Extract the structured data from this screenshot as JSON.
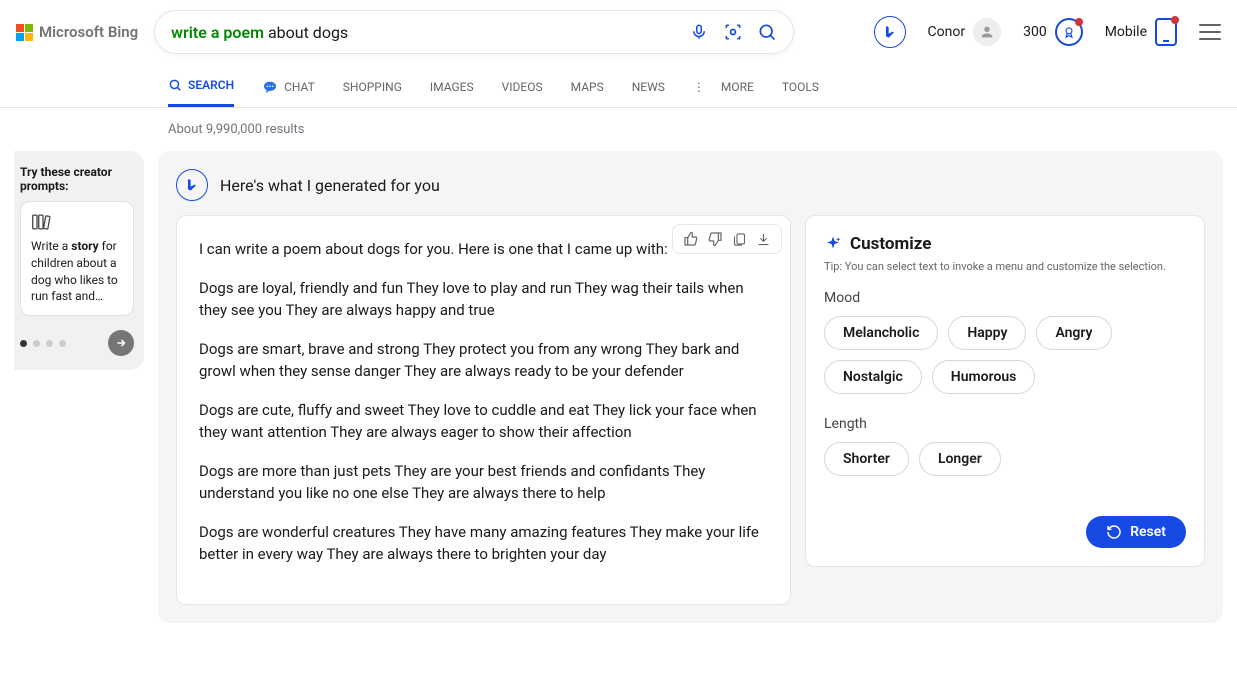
{
  "logo_text": "Microsoft Bing",
  "search": {
    "highlight": "write a poem",
    "rest": " about dogs"
  },
  "user_name": "Conor",
  "points": "300",
  "mobile_label": "Mobile",
  "nav": {
    "search": "SEARCH",
    "chat": "CHAT",
    "shopping": "SHOPPING",
    "images": "IMAGES",
    "videos": "VIDEOS",
    "maps": "MAPS",
    "news": "NEWS",
    "more": "MORE",
    "tools": "TOOLS"
  },
  "results_count": "About 9,990,000 results",
  "creator": {
    "title": "Try these creator prompts:",
    "card_prefix": "Write a ",
    "card_bold": "story",
    "card_suffix": " for children about a dog who likes to run fast and…"
  },
  "generated": {
    "heading": "Here's what I generated for you",
    "paragraphs": [
      "I can write a poem about dogs for you. Here is one that I came up with:",
      "Dogs are loyal, friendly and fun They love to play and run They wag their tails when they see you They are always happy and true",
      "Dogs are smart, brave and strong They protect you from any wrong They bark and growl when they sense danger They are always ready to be your defender",
      "Dogs are cute, fluffy and sweet They love to cuddle and eat They lick your face when they want attention They are always eager to show their affection",
      "Dogs are more than just pets They are your best friends and confidants They understand you like no one else They are always there to help",
      "Dogs are wonderful creatures They have many amazing features They make your life better in every way They are always there to brighten your day"
    ]
  },
  "customize": {
    "title": "Customize",
    "tip": "Tip: You can select text to invoke a menu and customize the selection.",
    "mood_label": "Mood",
    "moods": [
      "Melancholic",
      "Happy",
      "Angry",
      "Nostalgic",
      "Humorous"
    ],
    "length_label": "Length",
    "lengths": [
      "Shorter",
      "Longer"
    ],
    "reset": "Reset"
  }
}
